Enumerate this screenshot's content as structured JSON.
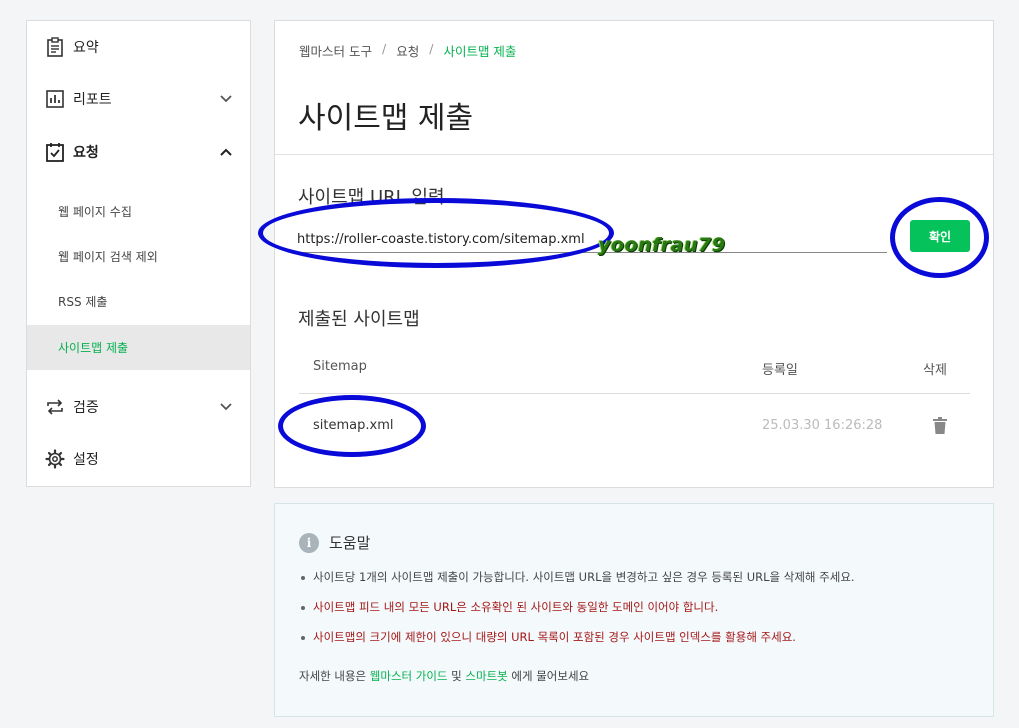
{
  "sidebar": {
    "items": [
      {
        "label": "요약",
        "icon": "clipboard-icon"
      },
      {
        "label": "리포트",
        "icon": "bar-chart-icon"
      },
      {
        "label": "요청",
        "icon": "checkbox-icon"
      },
      {
        "label": "검증",
        "icon": "repeat-icon"
      },
      {
        "label": "설정",
        "icon": "gear-icon"
      }
    ],
    "subitems": [
      {
        "label": "웹 페이지 수집"
      },
      {
        "label": "웹 페이지 검색 제외"
      },
      {
        "label": "RSS 제출"
      },
      {
        "label": "사이트맵 제출"
      }
    ]
  },
  "breadcrumb": {
    "items": [
      "웹마스터 도구",
      "요청",
      "사이트맵 제출"
    ],
    "separator": "/"
  },
  "main": {
    "title": "사이트맵 제출",
    "url_label": "사이트맵 URL 입력",
    "url_value": "https://roller-coaste.tistory.com/sitemap.xml",
    "confirm_label": "확인",
    "submitted_title": "제출된 사이트맵",
    "table": {
      "headers": [
        "Sitemap",
        "등록일",
        "삭제"
      ],
      "rows": [
        {
          "sitemap": "sitemap.xml",
          "date": "25.03.30 16:26:28"
        }
      ]
    }
  },
  "help": {
    "title": "도움말",
    "info_glyph": "i",
    "items": [
      "사이트당 1개의 사이트맵 제출이 가능합니다. 사이트맵 URL을 변경하고 싶은 경우 등록된 URL을 삭제해 주세요.",
      "사이트맵 피드 내의 모든 URL은 소유확인 된 사이트와 동일한 도메인 이어야 합니다.",
      "사이트맵의 크기에 제한이 있으니 대량의 URL 목록이 포함된 경우 사이트맵 인덱스를 활용해 주세요."
    ],
    "footer_prefix": "자세한 내용은",
    "footer_link1": "웹마스터 가이드",
    "footer_mid": "및",
    "footer_link2": "스마트봇",
    "footer_suffix": "에게 물어보세요"
  },
  "watermark": "yoonfrau79",
  "colors": {
    "accent": "#06b14f",
    "button": "#05c35a",
    "warning": "#a41818",
    "annotation": "#0a0ad8"
  }
}
